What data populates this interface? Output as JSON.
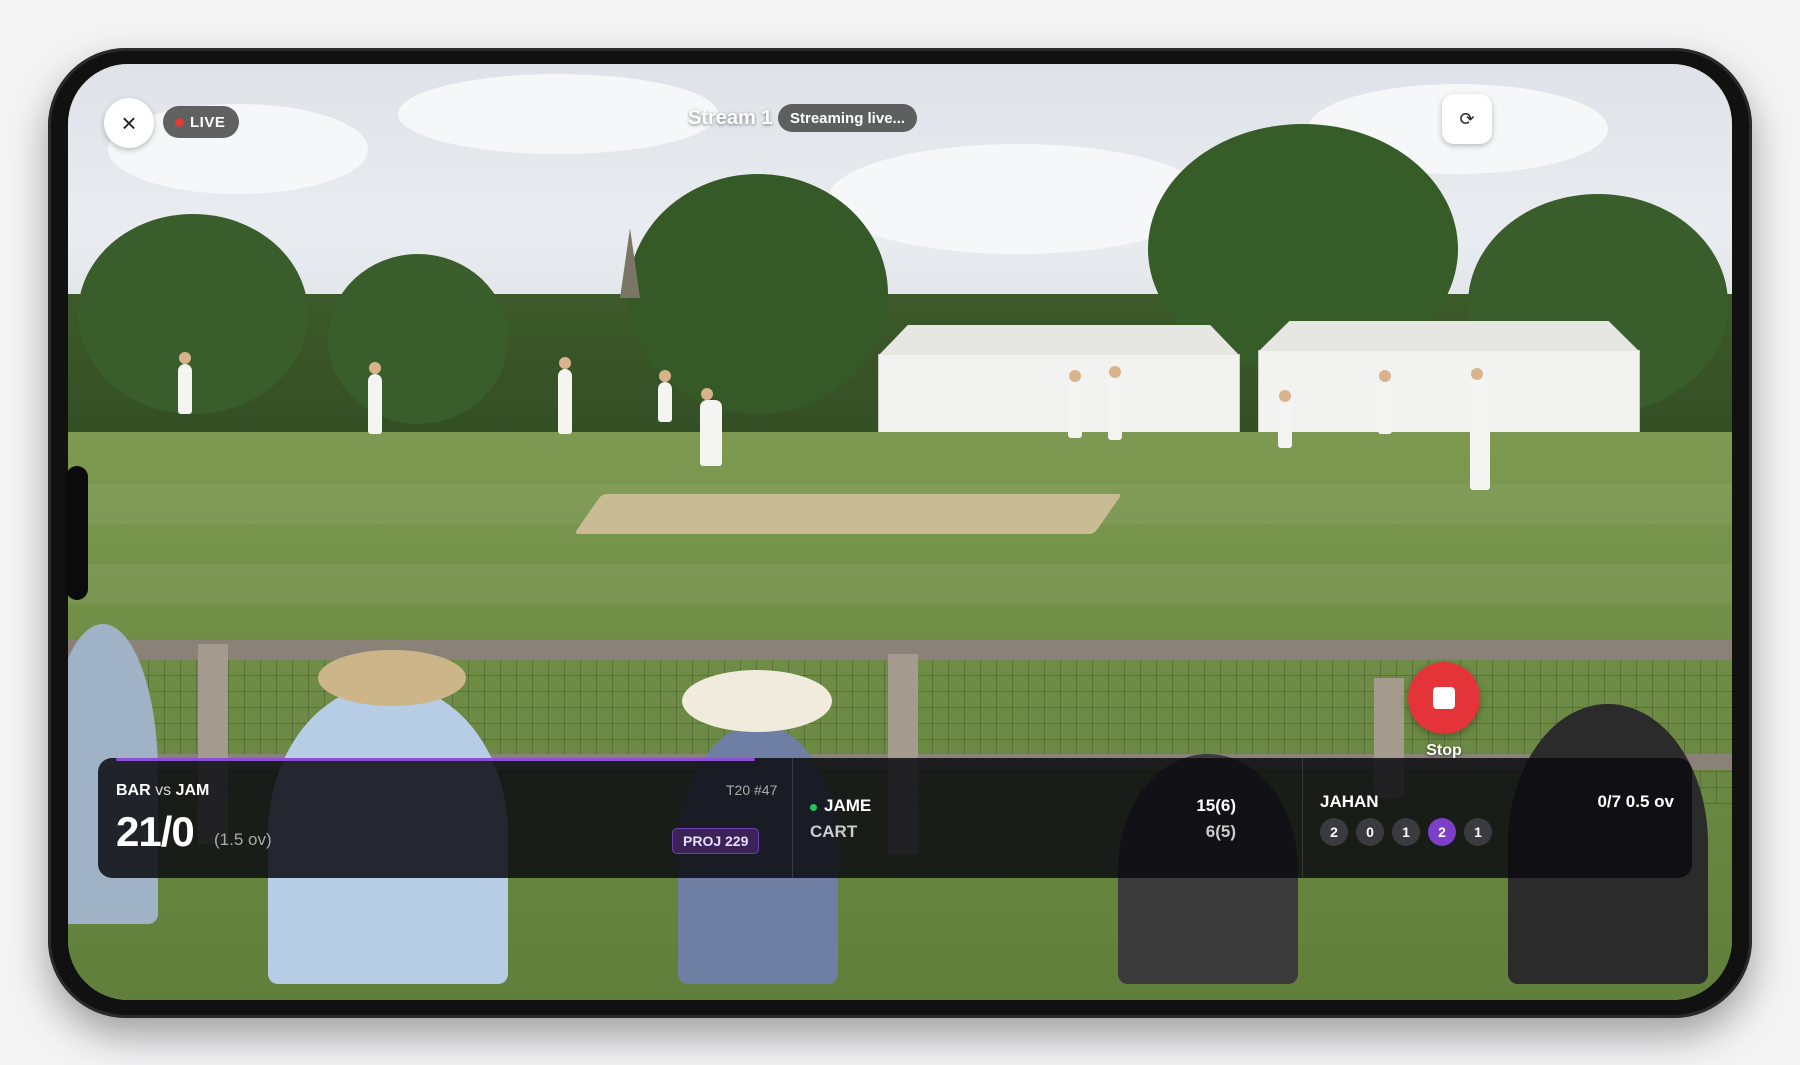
{
  "header": {
    "live_label": "LIVE",
    "stream_title": "Stream 1",
    "status": "Streaming live..."
  },
  "icons": {
    "close": "×",
    "refresh": "⟳"
  },
  "stop": {
    "label": "Stop"
  },
  "scorecard": {
    "team_a": "BAR",
    "vs": "vs",
    "team_b": "JAM",
    "score": "21/0",
    "overs": "(1.5 ov)",
    "match_tag": "T20 #47",
    "projection": "PROJ 229",
    "progress_fraction": 0.41,
    "batters": [
      {
        "name": "JAME",
        "score": "15(6)",
        "on_strike": true
      },
      {
        "name": "CART",
        "score": "6(5)",
        "on_strike": false
      }
    ],
    "bowler": {
      "name": "JAHAN",
      "figures": "0/7 0.5 ov",
      "recent_balls": [
        "2",
        "0",
        "1",
        "2",
        "1"
      ],
      "highlighted_ball_index": 3
    }
  },
  "colors": {
    "live_dot": "#e53935",
    "stop": "#e5333a",
    "accent": "#8b4fd6",
    "on_strike": "#22c55e"
  }
}
